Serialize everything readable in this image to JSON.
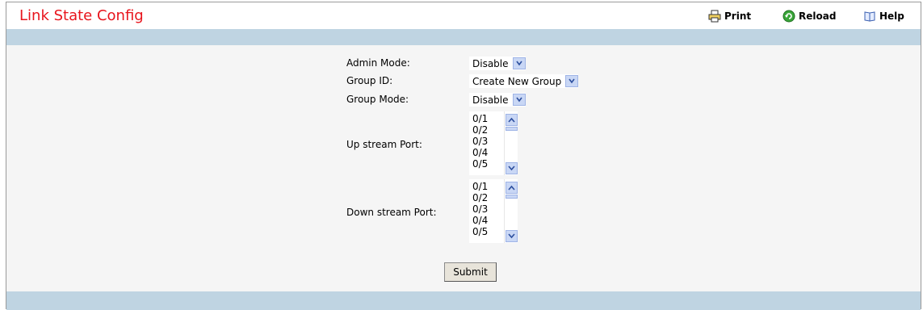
{
  "header": {
    "title": "Link State Config",
    "print_label": "Print",
    "reload_label": "Reload",
    "help_label": "Help",
    "icons": [
      "printer-icon",
      "reload-icon",
      "help-book-icon"
    ]
  },
  "form": {
    "admin_mode": {
      "label": "Admin Mode:",
      "value": "Disable"
    },
    "group_id": {
      "label": "Group ID:",
      "value": "Create New Group"
    },
    "group_mode": {
      "label": "Group Mode:",
      "value": "Disable"
    },
    "upstream": {
      "label": "Up stream Port:",
      "options": [
        "0/1",
        "0/2",
        "0/3",
        "0/4",
        "0/5"
      ]
    },
    "downstream": {
      "label": "Down stream Port:",
      "options": [
        "0/1",
        "0/2",
        "0/3",
        "0/4",
        "0/5"
      ]
    },
    "submit_label": "Submit"
  },
  "colors": {
    "title": "#e8141c",
    "bar": "#bfd4e2",
    "background": "#f5f5f5",
    "control_button": "#c9d7f5"
  }
}
